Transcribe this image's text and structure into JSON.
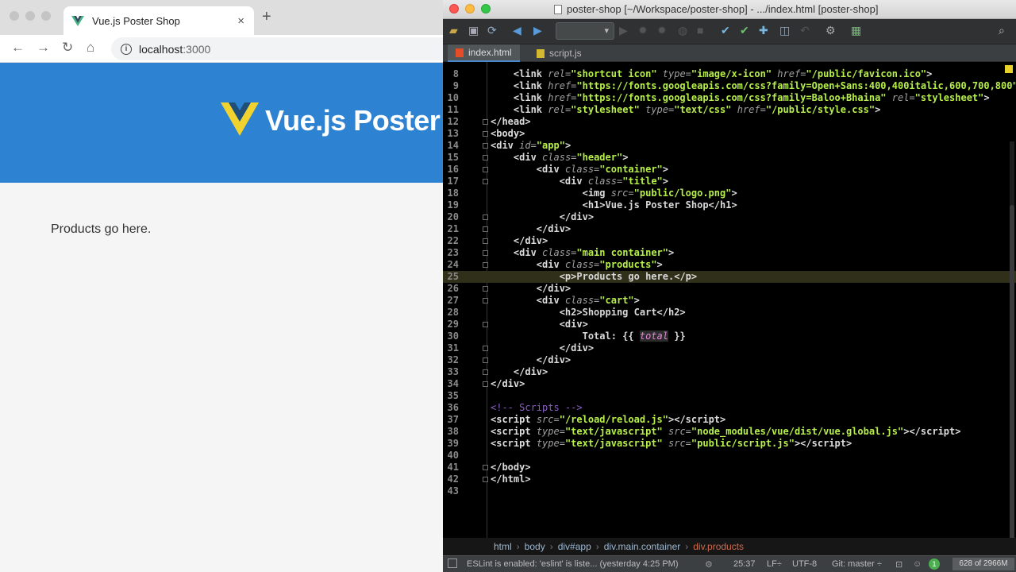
{
  "browser": {
    "tab_title": "Vue.js Poster Shop",
    "close_glyph": "×",
    "new_tab_glyph": "+",
    "url_host": "localhost",
    "url_port": ":3000",
    "page_title": "Vue.js Poster Shop",
    "products_text": "Products go here.",
    "header_color": "#2d82d1"
  },
  "ide": {
    "window_title": "poster-shop [~/Workspace/poster-shop] - .../index.html [poster-shop]",
    "tabs": [
      {
        "label": "index.html",
        "active": true
      },
      {
        "label": "script.js",
        "active": false
      }
    ],
    "breadcrumbs": [
      "html",
      "body",
      "div#app",
      "div.main.container",
      "div.products"
    ],
    "status": {
      "eslint": "ESLint is enabled: 'eslint' is liste... (yesterday 4:25 PM)",
      "position": "25:37",
      "line_sep": "LF÷",
      "encoding": "UTF-8",
      "git": "Git: master ÷",
      "memory": "628 of 2966M"
    },
    "code_lines": [
      {
        "n": 8,
        "html": "    <span class=\"tag\">&lt;link</span> <span class=\"attr\">rel=</span><span class=\"val\">\"shortcut icon\"</span> <span class=\"attr\">type=</span><span class=\"val\">\"image/x-icon\"</span> <span class=\"attr\">href=</span><span class=\"val\">\"/public/favicon.ico\"</span><span class=\"tag\">&gt;</span>"
      },
      {
        "n": 9,
        "html": "    <span class=\"tag\">&lt;link</span> <span class=\"attr\">href=</span><span class=\"val\">\"https://fonts.googleapis.com/css?family=Open+Sans:400,400italic,600,700,800\"</span>"
      },
      {
        "n": 10,
        "html": "    <span class=\"tag\">&lt;link</span> <span class=\"attr\">href=</span><span class=\"val\">\"https://fonts.googleapis.com/css?family=Baloo+Bhaina\"</span> <span class=\"attr\">rel=</span><span class=\"val\">\"stylesheet\"</span><span class=\"tag\">&gt;</span>"
      },
      {
        "n": 11,
        "html": "    <span class=\"tag\">&lt;link</span> <span class=\"attr\">rel=</span><span class=\"val\">\"stylesheet\"</span> <span class=\"attr\">type=</span><span class=\"val\">\"text/css\"</span> <span class=\"attr\">href=</span><span class=\"val\">\"/public/style.css\"</span><span class=\"tag\">&gt;</span>"
      },
      {
        "n": 12,
        "fold": true,
        "html": "<span class=\"tag\">&lt;/head&gt;</span>"
      },
      {
        "n": 13,
        "fold": true,
        "html": "<span class=\"tag\">&lt;body&gt;</span>"
      },
      {
        "n": 14,
        "fold": true,
        "html": "<span class=\"tag\">&lt;div</span> <span class=\"attr\">id=</span><span class=\"val\">\"app\"</span><span class=\"tag\">&gt;</span>"
      },
      {
        "n": 15,
        "fold": true,
        "html": "    <span class=\"tag\">&lt;div</span> <span class=\"attr\">class=</span><span class=\"val\">\"header\"</span><span class=\"tag\">&gt;</span>"
      },
      {
        "n": 16,
        "fold": true,
        "html": "        <span class=\"tag\">&lt;div</span> <span class=\"attr\">class=</span><span class=\"val\">\"container\"</span><span class=\"tag\">&gt;</span>"
      },
      {
        "n": 17,
        "fold": true,
        "html": "            <span class=\"tag\">&lt;div</span> <span class=\"attr\">class=</span><span class=\"val\">\"title\"</span><span class=\"tag\">&gt;</span>"
      },
      {
        "n": 18,
        "html": "                <span class=\"tag\">&lt;img</span> <span class=\"attr\">src=</span><span class=\"val\">\"public/logo.png\"</span><span class=\"tag\">&gt;</span>"
      },
      {
        "n": 19,
        "html": "                <span class=\"tag\">&lt;h1&gt;</span><span class=\"txt\">Vue.js Poster Shop</span><span class=\"tag\">&lt;/h1&gt;</span>"
      },
      {
        "n": 20,
        "fold": true,
        "html": "            <span class=\"tag\">&lt;/div&gt;</span>"
      },
      {
        "n": 21,
        "fold": true,
        "html": "        <span class=\"tag\">&lt;/div&gt;</span>"
      },
      {
        "n": 22,
        "fold": true,
        "html": "    <span class=\"tag\">&lt;/div&gt;</span>"
      },
      {
        "n": 23,
        "fold": true,
        "html": "    <span class=\"tag\">&lt;div</span> <span class=\"attr\">class=</span><span class=\"val\">\"main container\"</span><span class=\"tag\">&gt;</span>"
      },
      {
        "n": 24,
        "fold": true,
        "html": "        <span class=\"tag\">&lt;div</span> <span class=\"attr\">class=</span><span class=\"val\">\"products\"</span><span class=\"tag\">&gt;</span>"
      },
      {
        "n": 25,
        "cur": true,
        "html": "            <span class=\"tag\">&lt;p&gt;</span><span class=\"txt\">Products go here.</span><span class=\"tag\">&lt;/p&gt;</span>"
      },
      {
        "n": 26,
        "fold": true,
        "html": "        <span class=\"tag\">&lt;/div&gt;</span>"
      },
      {
        "n": 27,
        "fold": true,
        "html": "        <span class=\"tag\">&lt;div</span> <span class=\"attr\">class=</span><span class=\"val\">\"cart\"</span><span class=\"tag\">&gt;</span>"
      },
      {
        "n": 28,
        "html": "            <span class=\"tag\">&lt;h2&gt;</span><span class=\"txt\">Shopping Cart</span><span class=\"tag\">&lt;/h2&gt;</span>"
      },
      {
        "n": 29,
        "fold": true,
        "html": "            <span class=\"tag\">&lt;div&gt;</span>"
      },
      {
        "n": 30,
        "html": "                <span class=\"txt\">Total: {{</span> <span class=\"tpl\">total</span> <span class=\"txt\">}}</span>"
      },
      {
        "n": 31,
        "fold": true,
        "html": "            <span class=\"tag\">&lt;/div&gt;</span>"
      },
      {
        "n": 32,
        "fold": true,
        "html": "        <span class=\"tag\">&lt;/div&gt;</span>"
      },
      {
        "n": 33,
        "fold": true,
        "html": "    <span class=\"tag\">&lt;/div&gt;</span>"
      },
      {
        "n": 34,
        "fold": true,
        "html": "<span class=\"tag\">&lt;/div&gt;</span>"
      },
      {
        "n": 35,
        "html": ""
      },
      {
        "n": 36,
        "html": "<span class=\"com\">&lt;!-- Scripts --&gt;</span>"
      },
      {
        "n": 37,
        "html": "<span class=\"tag\">&lt;script</span> <span class=\"attr\">src=</span><span class=\"val\">\"/reload/reload.js\"</span><span class=\"tag\">&gt;&lt;/script&gt;</span>"
      },
      {
        "n": 38,
        "html": "<span class=\"tag\">&lt;script</span> <span class=\"attr\">type=</span><span class=\"val\">\"text/javascript\"</span> <span class=\"attr\">src=</span><span class=\"val\">\"node_modules/vue/dist/vue.global.js\"</span><span class=\"tag\">&gt;&lt;/script&gt;</span>"
      },
      {
        "n": 39,
        "html": "<span class=\"tag\">&lt;script</span> <span class=\"attr\">type=</span><span class=\"val\">\"text/javascript\"</span> <span class=\"attr\">src=</span><span class=\"val\">\"public/script.js\"</span><span class=\"tag\">&gt;&lt;/script&gt;</span>"
      },
      {
        "n": 40,
        "html": ""
      },
      {
        "n": 41,
        "fold": true,
        "html": "<span class=\"tag\">&lt;/body&gt;</span>"
      },
      {
        "n": 42,
        "fold": true,
        "html": "<span class=\"tag\">&lt;/html&gt;</span>"
      },
      {
        "n": 43,
        "html": ""
      }
    ]
  }
}
